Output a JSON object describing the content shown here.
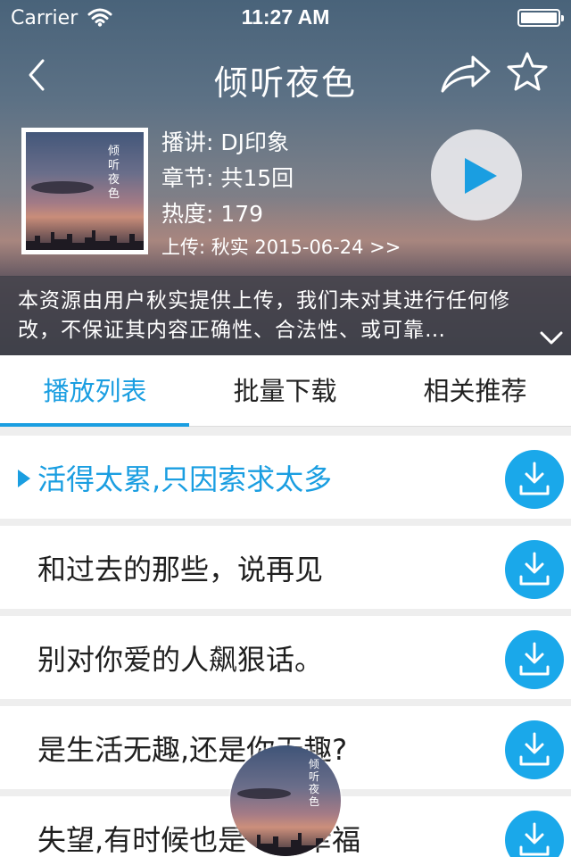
{
  "status_bar": {
    "carrier": "Carrier",
    "time": "11:27 AM"
  },
  "header": {
    "title": "倾听夜色"
  },
  "album": {
    "cover_text": "倾听夜色",
    "narrator": "播讲: DJ印象",
    "chapters": "章节: 共15回",
    "popularity": "热度: 179",
    "uploader": "上传: 秋实 2015-06-24 >>"
  },
  "description": "本资源由用户秋实提供上传，我们未对其进行任何修改，不保证其内容正确性、合法性、或可靠…",
  "tabs": [
    {
      "label": "播放列表",
      "active": true
    },
    {
      "label": "批量下载",
      "active": false
    },
    {
      "label": "相关推荐",
      "active": false
    }
  ],
  "playlist": [
    {
      "title": "活得太累,只因索求太多",
      "playing": true
    },
    {
      "title": "和过去的那些，说再见",
      "playing": false
    },
    {
      "title": "别对你爱的人飙狠话。",
      "playing": false
    },
    {
      "title": "是生活无趣,还是你无趣?",
      "playing": false
    },
    {
      "title": "失望,有时候也是一种幸福",
      "playing": false
    }
  ],
  "colors": {
    "accent": "#1a9ee1",
    "download_button": "#1aa8ea"
  },
  "icons": [
    "wifi-icon",
    "battery-icon",
    "back-icon",
    "share-icon",
    "star-icon",
    "play-icon",
    "chevron-down-icon",
    "download-icon"
  ]
}
